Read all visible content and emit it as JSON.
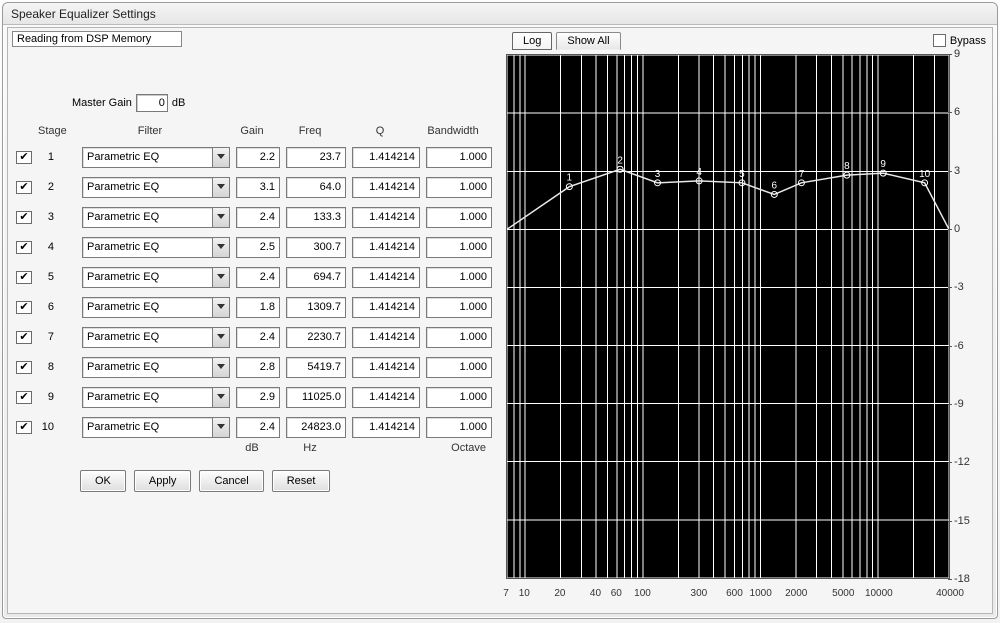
{
  "window": {
    "title": "Speaker Equalizer Settings"
  },
  "status": "Reading from DSP Memory",
  "master_gain": {
    "label": "Master Gain",
    "value": "0",
    "unit": "dB"
  },
  "headers": {
    "stage": "Stage",
    "filter": "Filter",
    "gain": "Gain",
    "freq": "Freq",
    "q": "Q",
    "bw": "Bandwidth"
  },
  "units": {
    "gain": "dB",
    "freq": "Hz",
    "bw": "Octave"
  },
  "stages": [
    {
      "num": "1",
      "enabled": true,
      "filter": "Parametric EQ",
      "gain": "2.2",
      "freq": "23.7",
      "q": "1.414214",
      "bw": "1.000"
    },
    {
      "num": "2",
      "enabled": true,
      "filter": "Parametric EQ",
      "gain": "3.1",
      "freq": "64.0",
      "q": "1.414214",
      "bw": "1.000"
    },
    {
      "num": "3",
      "enabled": true,
      "filter": "Parametric EQ",
      "gain": "2.4",
      "freq": "133.3",
      "q": "1.414214",
      "bw": "1.000"
    },
    {
      "num": "4",
      "enabled": true,
      "filter": "Parametric EQ",
      "gain": "2.5",
      "freq": "300.7",
      "q": "1.414214",
      "bw": "1.000"
    },
    {
      "num": "5",
      "enabled": true,
      "filter": "Parametric EQ",
      "gain": "2.4",
      "freq": "694.7",
      "q": "1.414214",
      "bw": "1.000"
    },
    {
      "num": "6",
      "enabled": true,
      "filter": "Parametric EQ",
      "gain": "1.8",
      "freq": "1309.7",
      "q": "1.414214",
      "bw": "1.000"
    },
    {
      "num": "7",
      "enabled": true,
      "filter": "Parametric EQ",
      "gain": "2.4",
      "freq": "2230.7",
      "q": "1.414214",
      "bw": "1.000"
    },
    {
      "num": "8",
      "enabled": true,
      "filter": "Parametric EQ",
      "gain": "2.8",
      "freq": "5419.7",
      "q": "1.414214",
      "bw": "1.000"
    },
    {
      "num": "9",
      "enabled": true,
      "filter": "Parametric EQ",
      "gain": "2.9",
      "freq": "11025.0",
      "q": "1.414214",
      "bw": "1.000"
    },
    {
      "num": "10",
      "enabled": true,
      "filter": "Parametric EQ",
      "gain": "2.4",
      "freq": "24823.0",
      "q": "1.414214",
      "bw": "1.000"
    }
  ],
  "buttons": {
    "ok": "OK",
    "apply": "Apply",
    "cancel": "Cancel",
    "reset": "Reset"
  },
  "tabs": {
    "log": "Log",
    "show_all": "Show All"
  },
  "bypass": {
    "label": "Bypass",
    "checked": false
  },
  "chart_data": {
    "type": "line",
    "title": "",
    "xlabel": "Hz",
    "ylabel": "dB",
    "xscale": "log",
    "xlim": [
      7,
      40000
    ],
    "ylim": [
      -18,
      9
    ],
    "x_ticks": [
      7,
      10,
      20,
      40,
      60,
      100,
      300,
      600,
      1000,
      2000,
      5000,
      10000,
      40000
    ],
    "y_ticks": [
      9,
      6,
      3,
      0,
      -3,
      -6,
      -9,
      -12,
      -15,
      -18
    ],
    "points": [
      {
        "n": 1,
        "freq": 23.7,
        "gain": 2.2
      },
      {
        "n": 2,
        "freq": 64.0,
        "gain": 3.1
      },
      {
        "n": 3,
        "freq": 133.3,
        "gain": 2.4
      },
      {
        "n": 4,
        "freq": 300.7,
        "gain": 2.5
      },
      {
        "n": 5,
        "freq": 694.7,
        "gain": 2.4
      },
      {
        "n": 6,
        "freq": 1309.7,
        "gain": 1.8
      },
      {
        "n": 7,
        "freq": 2230.7,
        "gain": 2.4
      },
      {
        "n": 8,
        "freq": 5419.7,
        "gain": 2.8
      },
      {
        "n": 9,
        "freq": 11025.0,
        "gain": 2.9
      },
      {
        "n": 10,
        "freq": 24823.0,
        "gain": 2.4
      }
    ]
  }
}
